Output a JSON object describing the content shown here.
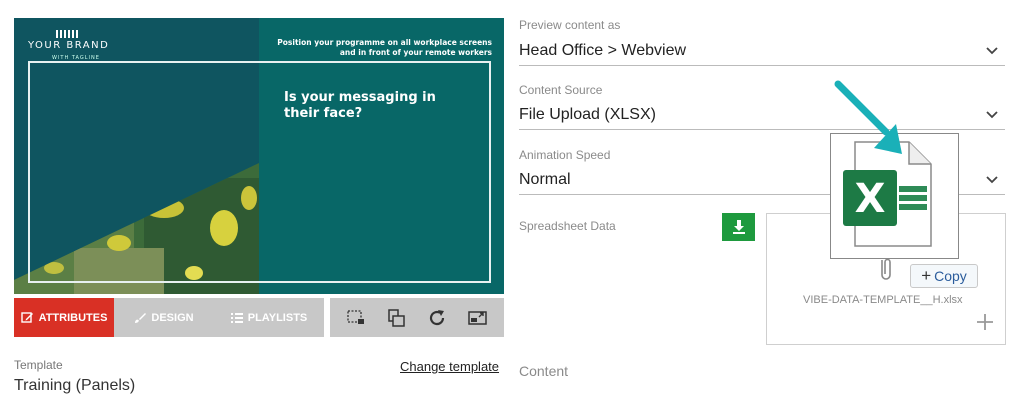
{
  "preview": {
    "brand": "YOUR BRAND",
    "brand_sub": "WITH TAGLINE",
    "tagline": "Position your programme on all workplace screens and in front of your remote workers",
    "headline": "Is your messaging in their face?"
  },
  "tabs": {
    "attributes": "ATTRIBUTES",
    "design": "DESIGN",
    "playlists": "PLAYLISTS"
  },
  "tools": [
    "crop-icon",
    "layers-icon",
    "refresh-icon",
    "cast-icon"
  ],
  "template": {
    "label": "Template",
    "value": "Training (Panels)",
    "change_link": "Change template"
  },
  "form": {
    "preview_as_label": "Preview content as",
    "preview_as_value": "Head Office > Webview",
    "source_label": "Content Source",
    "source_value": "File Upload (XLSX)",
    "speed_label": "Animation Speed",
    "speed_value": "Normal",
    "spreadsheet_label": "Spreadsheet Data",
    "copy_label": "Copy",
    "filename": "VIBE-DATA-TEMPLATE__H.xlsx",
    "content_label": "Content"
  },
  "colors": {
    "accent_red": "#d93025",
    "download_green": "#1e9a3e",
    "excel_green": "#1d7a45",
    "arrow_teal": "#1ab0b8",
    "preview_teal": "#086767"
  }
}
